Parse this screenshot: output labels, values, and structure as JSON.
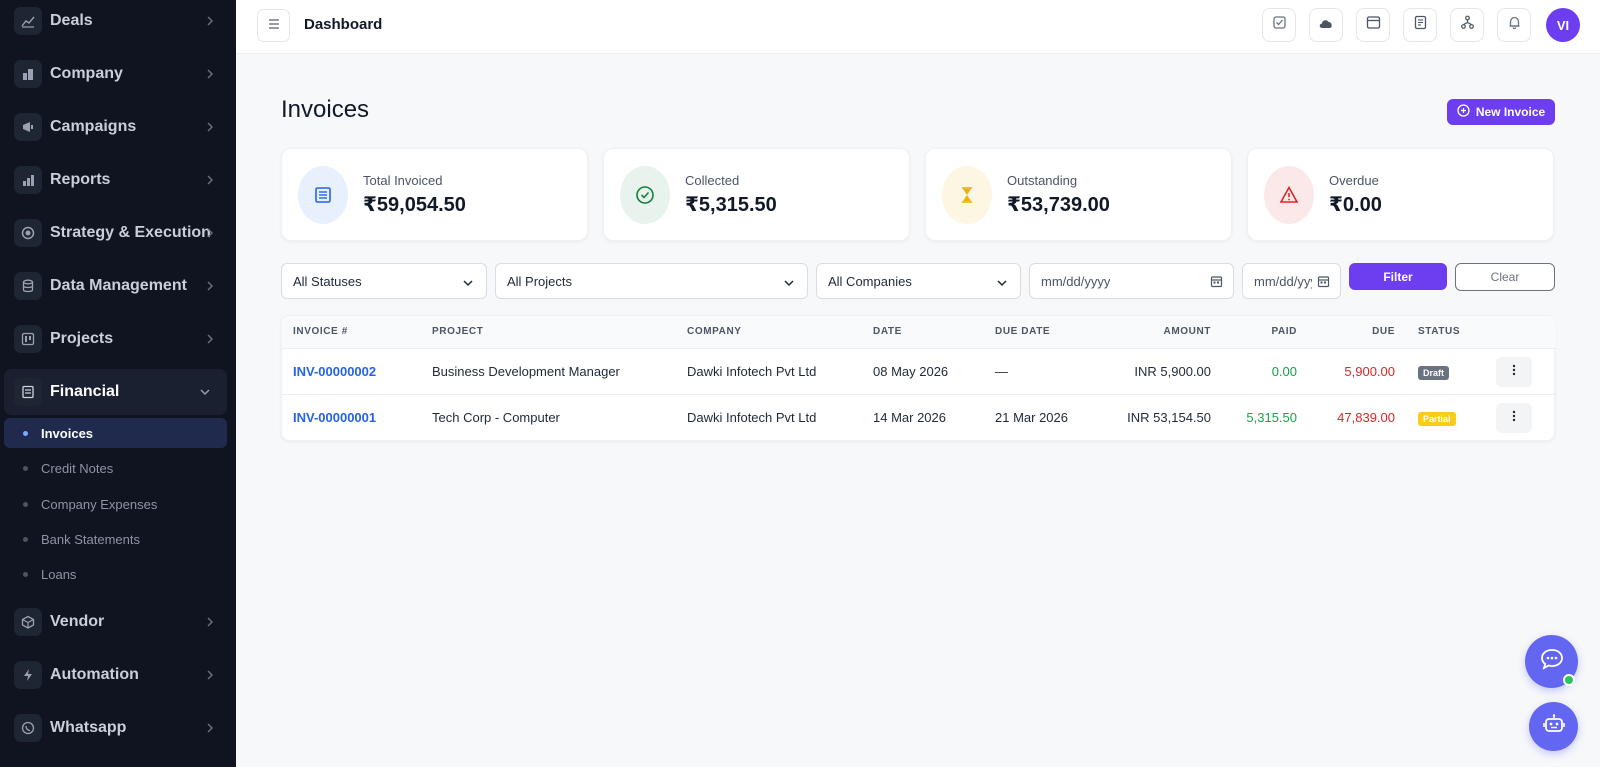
{
  "sidebar": {
    "items": [
      {
        "label": "Deals",
        "icon": "chart-line-icon"
      },
      {
        "label": "Company",
        "icon": "building-icon"
      },
      {
        "label": "Campaigns",
        "icon": "megaphone-icon"
      },
      {
        "label": "Reports",
        "icon": "bar-chart-icon"
      },
      {
        "label": "Strategy & Execution",
        "icon": "target-icon"
      },
      {
        "label": "Data Management",
        "icon": "database-icon"
      },
      {
        "label": "Projects",
        "icon": "kanban-icon"
      },
      {
        "label": "Financial",
        "icon": "receipt-icon",
        "expanded": true
      },
      {
        "label": "Vendor",
        "icon": "box-icon"
      },
      {
        "label": "Automation",
        "icon": "lightning-icon"
      },
      {
        "label": "Whatsapp",
        "icon": "whatsapp-icon"
      }
    ],
    "financial_sub": [
      {
        "label": "Invoices",
        "active": true
      },
      {
        "label": "Credit Notes"
      },
      {
        "label": "Company Expenses"
      },
      {
        "label": "Bank Statements"
      },
      {
        "label": "Loans"
      }
    ]
  },
  "topbar": {
    "title": "Dashboard",
    "icons": [
      "task-check-icon",
      "cloud-icon",
      "calendar-window-icon",
      "notes-icon",
      "org-tree-icon",
      "bell-icon"
    ],
    "avatar_initials": "VI"
  },
  "page": {
    "title": "Invoices",
    "new_button": "New Invoice"
  },
  "stats": [
    {
      "label": "Total Invoiced",
      "value": "₹59,054.50",
      "icon": "invoice-list-icon",
      "color": "#2563eb",
      "bg": "#e8f0fd"
    },
    {
      "label": "Collected",
      "value": "₹5,315.50",
      "icon": "check-circle-icon",
      "color": "#15803d",
      "bg": "#e7f3ec"
    },
    {
      "label": "Outstanding",
      "value": "₹53,739.00",
      "icon": "hourglass-icon",
      "color": "#eab308",
      "bg": "#fdf6e3"
    },
    {
      "label": "Overdue",
      "value": "₹0.00",
      "icon": "warning-triangle-icon",
      "color": "#dc2626",
      "bg": "#fbe9ea"
    }
  ],
  "filters": {
    "status": "All Statuses",
    "project": "All Projects",
    "company": "All Companies",
    "date_from_placeholder": "mm/dd/yyyy",
    "date_to_placeholder": "mm/dd/yyyy",
    "filter_button": "Filter",
    "clear_button": "Clear"
  },
  "table": {
    "headers": {
      "invoice": "INVOICE #",
      "project": "PROJECT",
      "company": "COMPANY",
      "date": "DATE",
      "due_date": "DUE DATE",
      "amount": "AMOUNT",
      "paid": "PAID",
      "due": "DUE",
      "status": "STATUS"
    },
    "rows": [
      {
        "invoice": "INV-00000002",
        "project": "Business Development Manager",
        "company": "Dawki Infotech Pvt Ltd",
        "date": "08 May 2026",
        "due_date": "—",
        "amount": "INR 5,900.00",
        "paid": "0.00",
        "due": "5,900.00",
        "status": "Draft"
      },
      {
        "invoice": "INV-00000001",
        "project": "Tech Corp - Computer",
        "company": "Dawki Infotech Pvt Ltd",
        "date": "14 Mar 2026",
        "due_date": "21 Mar 2026",
        "amount": "INR 53,154.50",
        "paid": "5,315.50",
        "due": "47,839.00",
        "status": "Partial"
      }
    ]
  },
  "colors": {
    "accent": "#6d3df0",
    "sidebar_bg": "#0f1420",
    "link": "#2563eb",
    "paid": "#16a34a",
    "due": "#dc2626"
  }
}
